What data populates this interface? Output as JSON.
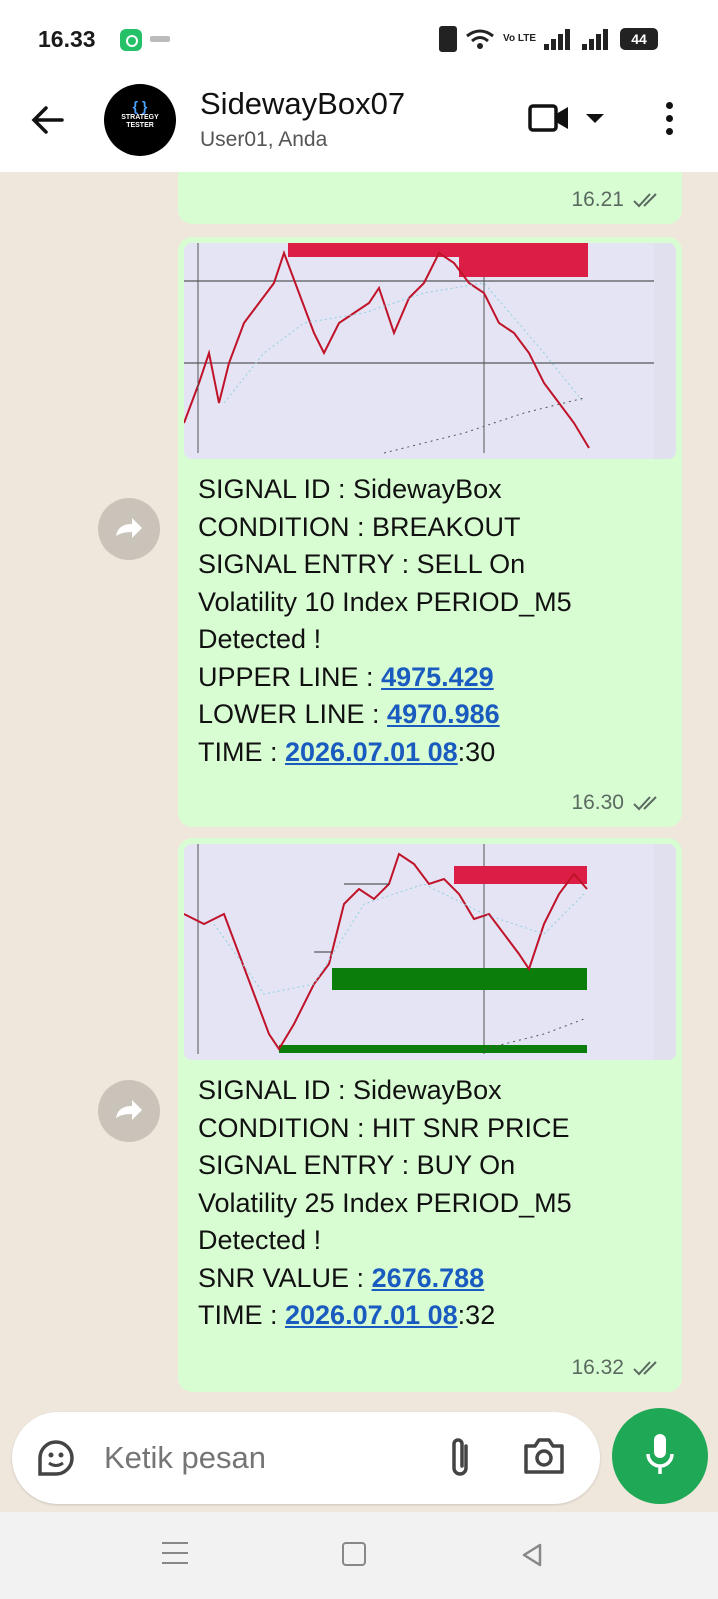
{
  "status": {
    "time": "16.33",
    "battery": "44",
    "volte": "Vo LTE"
  },
  "chat": {
    "title": "SidewayBox07",
    "subtitle": "User01, Anda"
  },
  "messages": [
    {
      "time": "16.21"
    },
    {
      "lines": [
        "SIGNAL ID : SidewayBox",
        "CONDITION : BREAKOUT",
        "SIGNAL ENTRY : SELL On",
        "Volatility 10 Index PERIOD_M5",
        "Detected !"
      ],
      "upper_label": "UPPER LINE : ",
      "upper_value": "4975.429",
      "lower_label": "LOWER LINE : ",
      "lower_value": "4970.986",
      "time_label": "TIME : ",
      "time_link": "2026.07.01 08",
      "time_rest": ":30",
      "time": "16.30"
    },
    {
      "lines": [
        "SIGNAL ID : SidewayBox",
        "CONDITION : HIT SNR PRICE",
        "SIGNAL ENTRY : BUY On",
        "Volatility 25 Index PERIOD_M5",
        "Detected !"
      ],
      "snr_label": "SNR VALUE : ",
      "snr_value": "2676.788",
      "time_label": "TIME : ",
      "time_link": "2026.07.01 08",
      "time_rest": ":32",
      "time": "16.32"
    }
  ],
  "composer": {
    "placeholder": "Ketik pesan"
  },
  "avatar": {
    "line1": "STRATEGY",
    "line2": "TESTER"
  },
  "icons": [
    "back-arrow-icon",
    "video-call-icon",
    "more-vert-icon",
    "forward-icon",
    "sticker-icon",
    "attach-icon",
    "camera-icon",
    "mic-icon",
    "double-check-icon"
  ],
  "colors": {
    "bubble": "#d9fdd3",
    "accent": "#1fa855",
    "link": "#1a5bbf"
  }
}
